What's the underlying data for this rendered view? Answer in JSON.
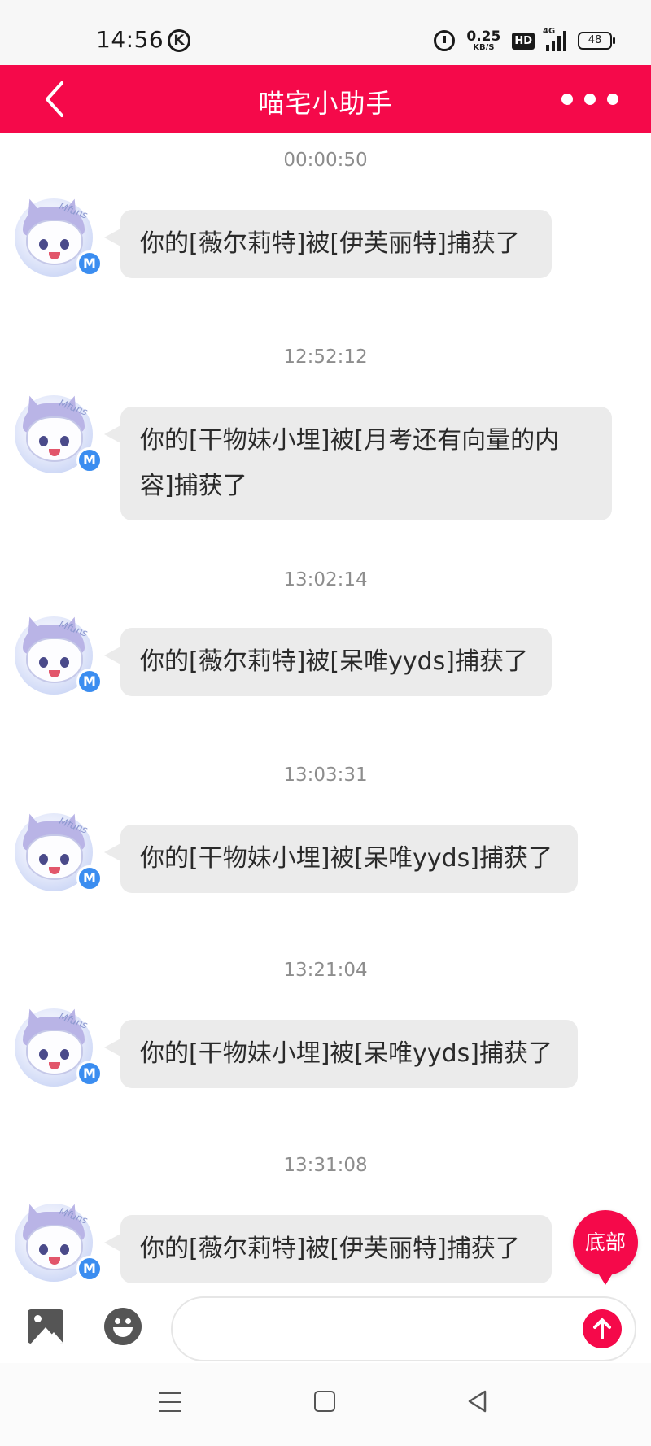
{
  "status_bar": {
    "time": "14:56",
    "k_badge": "K",
    "net_speed_value": "0.25",
    "net_speed_unit": "KB/S",
    "hd": "HD",
    "network": "4G",
    "battery": "48",
    "icons": [
      "alarm-icon",
      "hd-icon",
      "signal-icon",
      "battery-icon"
    ]
  },
  "header": {
    "title": "喵宅小助手",
    "back_icon": "chevron-left-icon",
    "more_icon": "more-dots-icon"
  },
  "messages": [
    {
      "time": "00:00:50",
      "text": "你的[薇尔莉特]被[伊芙丽特]捕获了"
    },
    {
      "time": "12:52:12",
      "text": "你的[干物妹小埋]被[月考还有向量的内容]捕获了"
    },
    {
      "time": "13:02:14",
      "text": "你的[薇尔莉特]被[呆唯yyds]捕获了"
    },
    {
      "time": "13:03:31",
      "text": "你的[干物妹小埋]被[呆唯yyds]捕获了"
    },
    {
      "time": "13:21:04",
      "text": "你的[干物妹小埋]被[呆唯yyds]捕获了"
    },
    {
      "time": "13:31:08",
      "text": "你的[薇尔莉特]被[伊芙丽特]捕获了"
    }
  ],
  "avatar": {
    "watermark": "Mfuns",
    "badge": "M"
  },
  "float_button": {
    "label": "底部"
  },
  "input_bar": {
    "placeholder": "",
    "image_icon": "image-icon",
    "emoji_icon": "emoji-icon",
    "send_icon": "send-arrow-up-icon"
  },
  "nav_bar": {
    "icons": [
      "menu-icon",
      "home-square-icon",
      "back-triangle-icon"
    ]
  },
  "colors": {
    "accent": "#f5094a",
    "bubble": "#ebebeb",
    "timestamp": "#8d8d8d"
  }
}
